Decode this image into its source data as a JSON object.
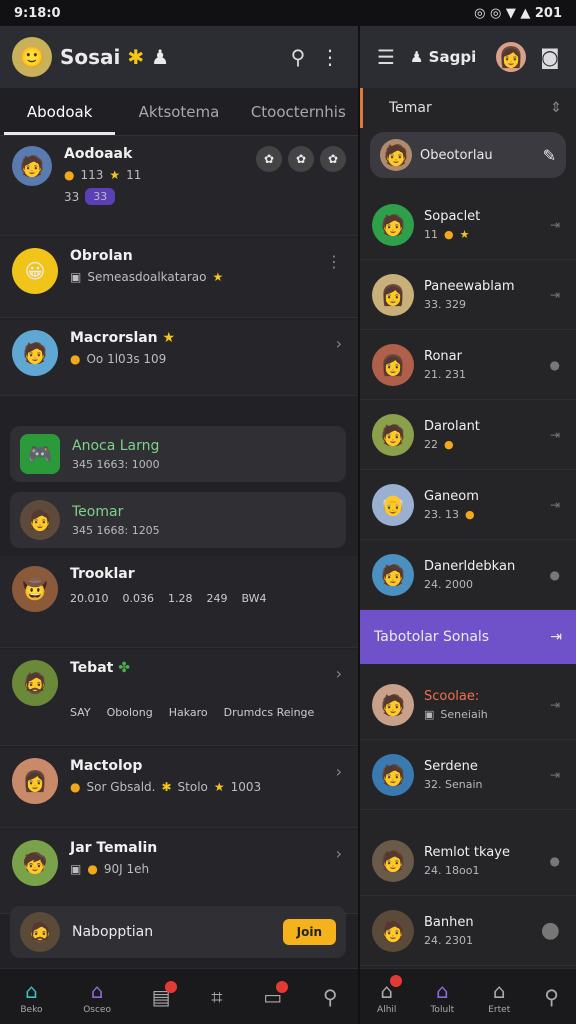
{
  "status": {
    "time": "9:18:0",
    "right": "◎ ◎ ▼ ▲ 201"
  },
  "left": {
    "brand": "Sosai",
    "tabs": [
      "Abodoak",
      "Aktsotema",
      "Ctoocternhis"
    ],
    "cards": [
      {
        "name": "Aodoaak",
        "sub": "113",
        "sub2": "11",
        "sub3": "33",
        "pill": "33"
      },
      {
        "name": "Obrolan",
        "sub": "Semeasdoalkatarao"
      },
      {
        "name": "Macrorslan",
        "sub": "Oo 1l03s 109"
      },
      {
        "name": "Anoca Larng",
        "sub": "345 1663: 1000"
      },
      {
        "name": "Teomar",
        "sub": "345 1668: 1205"
      },
      {
        "name": "Trooklar",
        "items": [
          "20.010",
          "0.036",
          "1.28",
          "249",
          "BW4"
        ]
      },
      {
        "name": "Tebat",
        "items": [
          "SAY",
          "Obolong",
          "Hakaro",
          "Drumdcs Reinge"
        ]
      },
      {
        "name": "Mactolop",
        "sub": "Sor Gbsald.",
        "sub2": "Stolo",
        "sub3": "1003"
      },
      {
        "name": "Jar Temalin",
        "sub": "90J 1eh"
      },
      {
        "name": "Nabopptian",
        "button": "Join"
      }
    ],
    "nav": [
      "Beko",
      "Osceo",
      "",
      "",
      "",
      ""
    ]
  },
  "right": {
    "title": "Sagpi",
    "section": "Temar",
    "search_value": "Obeotorlau",
    "rows": [
      {
        "name": "Sopaclet",
        "sub": "11"
      },
      {
        "name": "Paneewablam",
        "sub": "33. 329"
      },
      {
        "name": "Ronar",
        "sub": "21. 231"
      },
      {
        "name": "Darolant",
        "sub": "22"
      },
      {
        "name": "Ganeom",
        "sub": "23. 13"
      },
      {
        "name": "Danerldebkan",
        "sub": "24. 2000"
      }
    ],
    "highlight": "Tabotolar Sonals",
    "rows2": [
      {
        "name": "Scoolae:",
        "sub": "Seneiaih"
      },
      {
        "name": "Serdene",
        "sub": "32. Senain"
      },
      {
        "name": "Remlot tkaye",
        "sub": "24. 18oo1"
      },
      {
        "name": "Banhen",
        "sub": "24. 2301"
      }
    ],
    "nav": [
      "Alhil",
      "Tolult",
      "Ertet",
      ""
    ]
  }
}
